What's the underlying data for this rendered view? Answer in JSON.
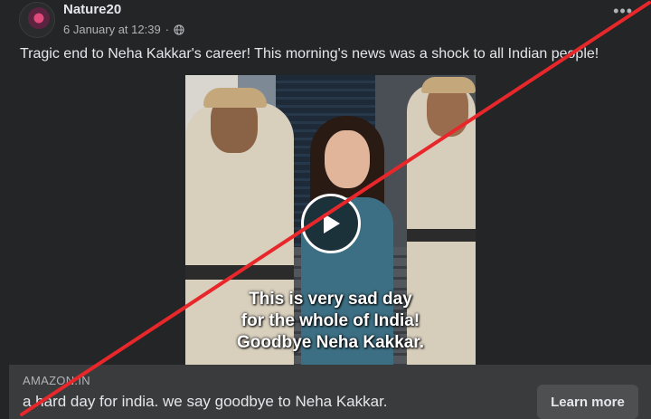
{
  "post": {
    "author": "Nature20",
    "timestamp": "6 January at 12:39",
    "visibility_icon": "globe-icon",
    "more_icon": "more-options-icon",
    "caption": "Tragic end to Neha Kakkar's career! This morning's news was a shock to all Indian people!"
  },
  "video": {
    "overlay_lines": [
      "This is very sad day",
      "for the whole of India!",
      "Goodbye Neha Kakkar."
    ],
    "play_icon": "play-icon"
  },
  "link_preview": {
    "domain": "AMAZON.IN",
    "title": "a hard day for india. we say goodbye to Neha Kakkar.",
    "cta_label": "Learn more"
  },
  "colors": {
    "background": "#242526",
    "link_bar": "#3a3b3c",
    "strike_line": "#e8272b"
  }
}
